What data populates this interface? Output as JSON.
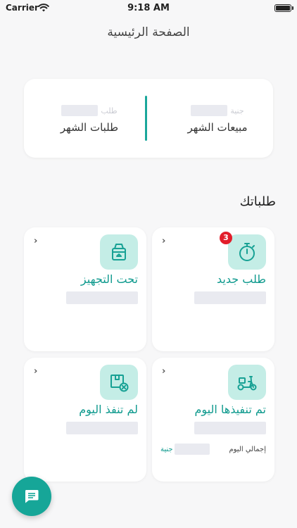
{
  "status_bar": {
    "carrier": "Carrier",
    "time": "9:18 AM"
  },
  "page_title": "الصفحة الرئيسية",
  "stats": {
    "sales": {
      "unit": "جنية",
      "label": "مبيعات الشهر"
    },
    "orders": {
      "unit": "طلب",
      "label": "طلبات الشهر"
    }
  },
  "section_title": "طلباتك",
  "tiles": [
    {
      "label": "طلب جديد",
      "badge": "3",
      "icon": "stopwatch-icon"
    },
    {
      "label": "تحت التجهيز",
      "icon": "package-icon"
    },
    {
      "label": "تم تنفيذها اليوم",
      "icon": "scooter-icon",
      "total_label": "إجمالي اليوم",
      "currency": "جنية"
    },
    {
      "label": "لم تنفذ اليوم",
      "icon": "box-cancel-icon"
    }
  ],
  "chevron": "‹",
  "colors": {
    "accent": "#16a698",
    "tile_icon_bg": "#c4ede6",
    "badge": "#e21d2a"
  }
}
